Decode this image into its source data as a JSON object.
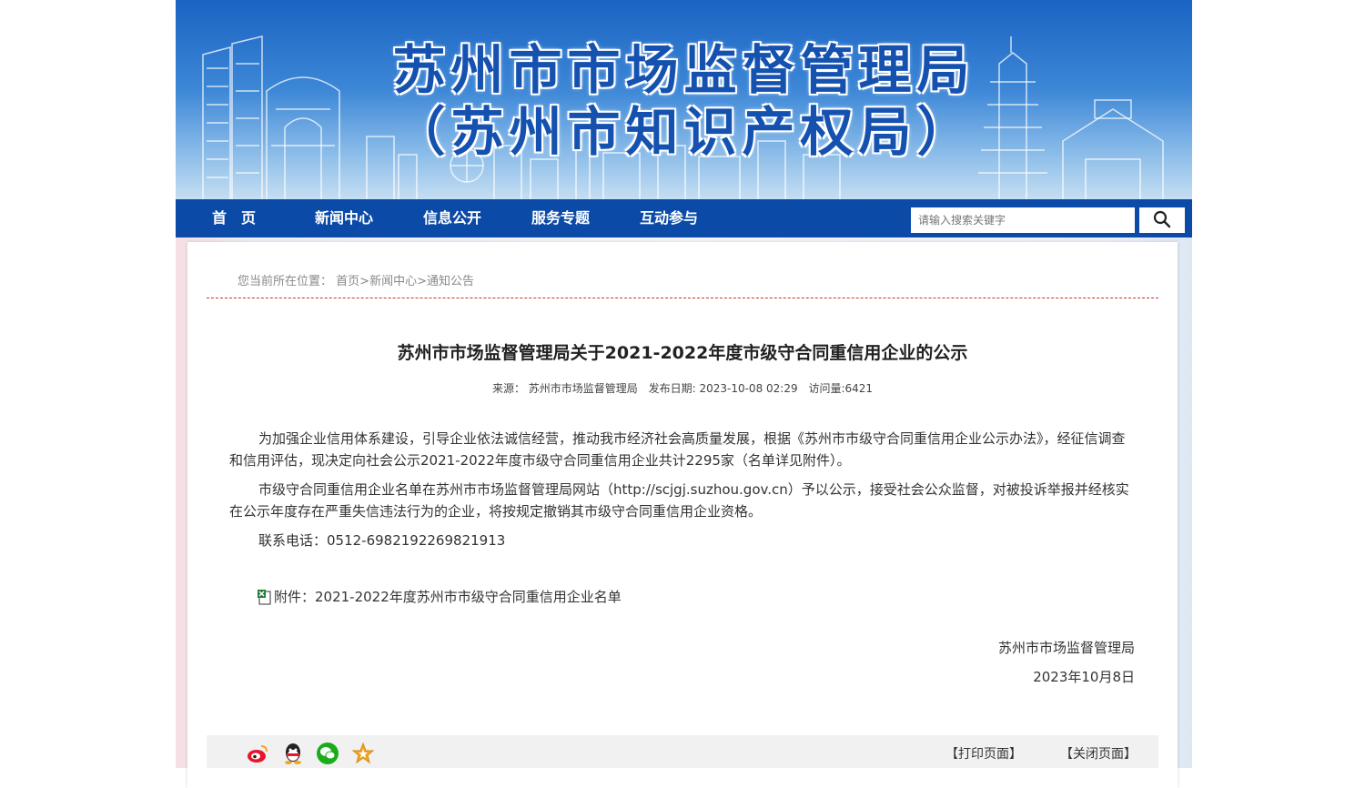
{
  "banner": {
    "title_line1": "苏州市市场监督管理局",
    "title_line2": "（苏州市知识产权局）"
  },
  "nav": {
    "items": [
      "首　页",
      "新闻中心",
      "信息公开",
      "服务专题",
      "互动参与"
    ],
    "search_placeholder": "请输入搜索关键字",
    "search_icon": "search-icon"
  },
  "breadcrumb": {
    "prefix": "您当前所在位置：",
    "items": [
      "首页",
      "新闻中心",
      "通知公告"
    ],
    "separator": ">"
  },
  "article": {
    "title": "苏州市市场监督管理局关于2021-2022年度市级守合同重信用企业的公示",
    "meta": {
      "source": "来源： 苏州市市场监督管理局",
      "published": "发布日期: 2023-10-08 02:29",
      "views": "访问量:6421"
    },
    "paragraphs": [
      "为加强企业信用体系建设，引导企业依法诚信经营，推动我市经济社会高质量发展，根据《苏州市市级守合同重信用企业公示办法》，经征信调查和信用评估，现决定向社会公示2021-2022年度市级守合同重信用企业共计2295家（名单详见附件）。",
      "市级守合同重信用企业名单在苏州市市场监督管理局网站（http://scjgj.suzhou.gov.cn）予以公示，接受社会公众监督，对被投诉举报并经核实在公示年度存在严重失信违法行为的企业，将按规定撤销其市级守合同重信用企业资格。",
      "联系电话：0512-6982192269821913"
    ],
    "attachment": "附件：2021-2022年度苏州市市级守合同重信用企业名单",
    "signature": "苏州市市场监督管理局",
    "date": "2023年10月8日"
  },
  "footer": {
    "share_icons": [
      "weibo-icon",
      "qq-icon",
      "wechat-icon",
      "favorite-star-icon"
    ],
    "print_label": "【打印页面】",
    "close_label": "【关闭页面】"
  },
  "colors": {
    "nav_bg": "#0b4aa6",
    "banner_title": "#1552b0",
    "divider": "#c0392b"
  }
}
